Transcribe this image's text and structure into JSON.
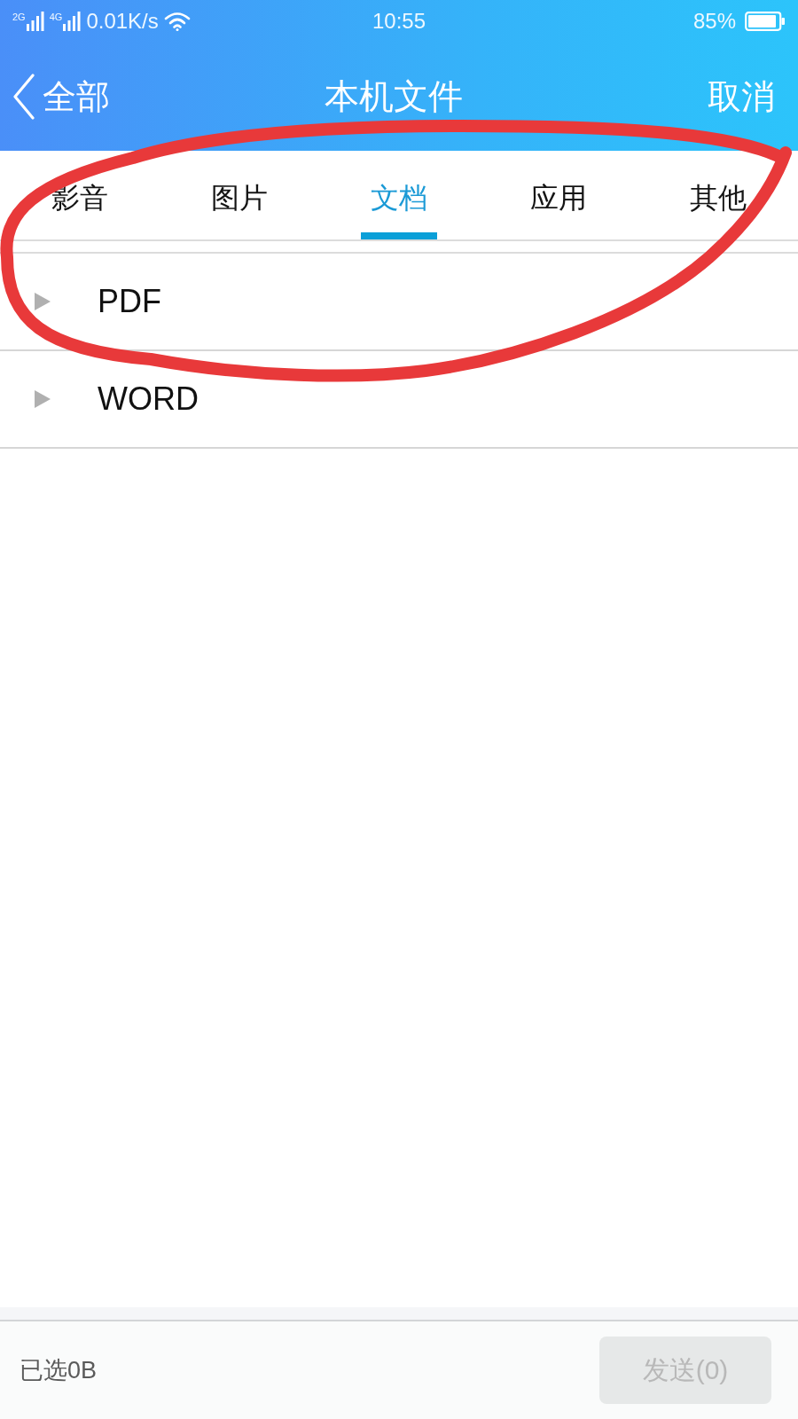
{
  "status_bar": {
    "networks": [
      {
        "label": "2G"
      },
      {
        "label": "4G"
      }
    ],
    "speed": "0.01K/s",
    "time": "10:55",
    "battery": "85%"
  },
  "header": {
    "back": "全部",
    "title": "本机文件",
    "action": "取消"
  },
  "tabs": [
    {
      "label": "影音",
      "selected": false
    },
    {
      "label": "图片",
      "selected": false
    },
    {
      "label": "文档",
      "selected": true
    },
    {
      "label": "应用",
      "selected": false
    },
    {
      "label": "其他",
      "selected": false
    }
  ],
  "groups": [
    {
      "name": "PDF",
      "expanded": false
    },
    {
      "name": "WORD",
      "expanded": false
    }
  ],
  "footer": {
    "selected_size": "已选0B",
    "send_button": {
      "label": "发送(0)",
      "disabled": true
    }
  }
}
